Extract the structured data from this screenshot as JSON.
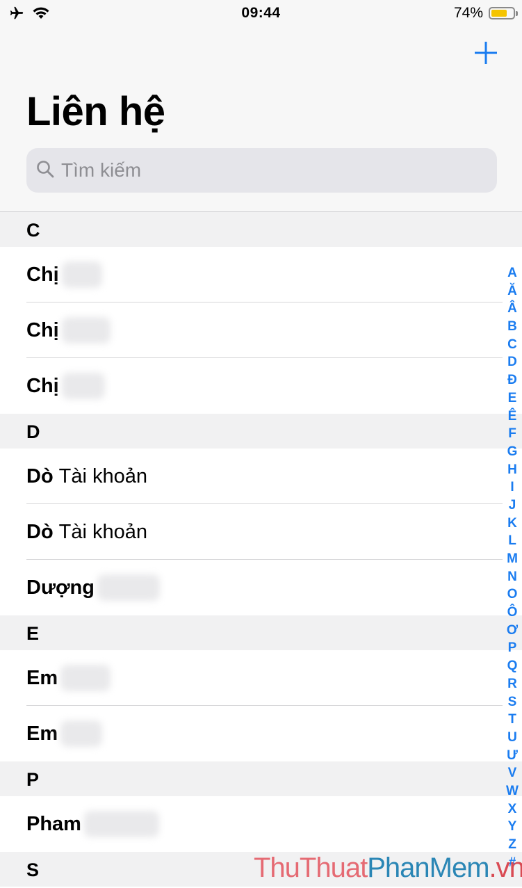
{
  "status_bar": {
    "time": "09:44",
    "battery_percent": "74%",
    "battery_level": 0.74,
    "icons": [
      "airplane-icon",
      "wifi-icon"
    ]
  },
  "header": {
    "add_label": "+",
    "title": "Liên hệ",
    "search_placeholder": "Tìm kiếm"
  },
  "sections": [
    {
      "letter": "C",
      "rows": [
        {
          "first": "Chị",
          "last": ""
        },
        {
          "first": "Chị",
          "last": ""
        },
        {
          "first": "Chị",
          "last": ""
        }
      ]
    },
    {
      "letter": "D",
      "rows": [
        {
          "first": "Dò",
          "last": "Tài khoản"
        },
        {
          "first": "Dò",
          "last": "Tài khoản"
        },
        {
          "first": "Dượng",
          "last": ""
        }
      ]
    },
    {
      "letter": "E",
      "rows": [
        {
          "first": "Em",
          "last": ""
        },
        {
          "first": "Em",
          "last": ""
        }
      ]
    },
    {
      "letter": "P",
      "rows": [
        {
          "first": "Pham",
          "last": ""
        }
      ]
    },
    {
      "letter": "S",
      "rows": []
    }
  ],
  "index_letters": [
    "A",
    "Ă",
    "Â",
    "B",
    "C",
    "D",
    "Đ",
    "E",
    "Ê",
    "F",
    "G",
    "H",
    "I",
    "J",
    "K",
    "L",
    "M",
    "N",
    "O",
    "Ô",
    "Ơ",
    "P",
    "Q",
    "R",
    "S",
    "T",
    "U",
    "Ư",
    "V",
    "W",
    "X",
    "Y",
    "Z",
    "#"
  ],
  "watermark": {
    "part1": "ThuThuat",
    "part2": "PhanMem",
    "part3": ".vn"
  },
  "colors": {
    "accent": "#1a7cf0",
    "battery": "#f5c400"
  }
}
